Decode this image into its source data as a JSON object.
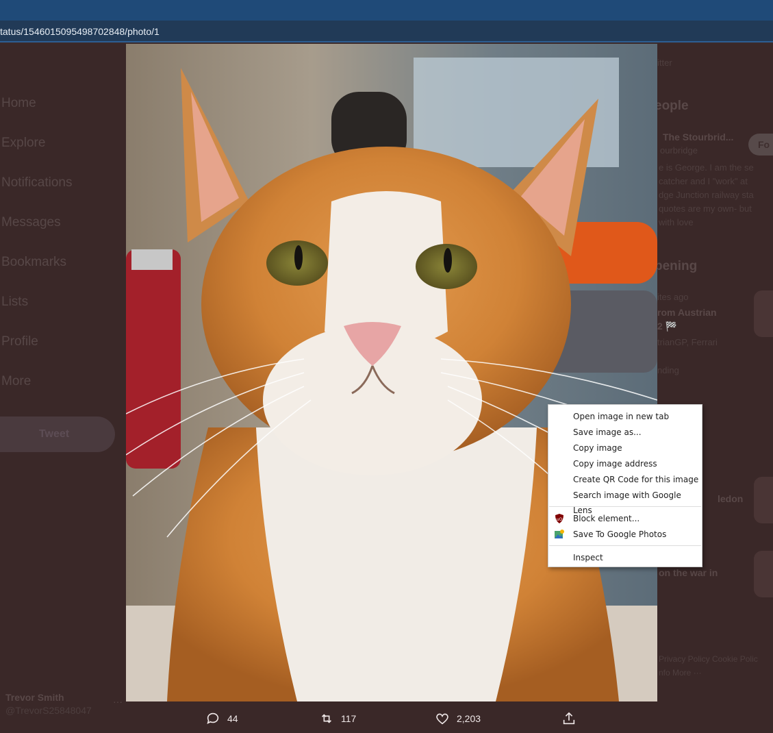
{
  "browser": {
    "url": "tatus/1546015095498702848/photo/1"
  },
  "sidebar": {
    "items": [
      {
        "label": "Home"
      },
      {
        "label": "Explore"
      },
      {
        "label": "Notifications"
      },
      {
        "label": "Messages"
      },
      {
        "label": "Bookmarks"
      },
      {
        "label": "Lists"
      },
      {
        "label": "Profile"
      },
      {
        "label": "More"
      }
    ],
    "tweet_button": "Tweet"
  },
  "account": {
    "name": "Trevor Smith",
    "handle": "@TrevorS25848047",
    "more": "···"
  },
  "right_column": {
    "search_hint": "itter",
    "people_heading": "eople",
    "person_name": "The Stourbrid...",
    "person_handle": "ourbridge",
    "follow_label": "Fo",
    "bio_lines": [
      "e is George. I am the se",
      "catcher and I \"work\" at",
      "dge Junction railway sta",
      "quotes are my own- but",
      "with love"
    ],
    "happening_heading": "pening",
    "trend_time": "ites ago",
    "trend_title_1": "rom Austrian",
    "trend_title_2": "2 🏁",
    "trend_sub": "trianGP, Ferrari",
    "trend_label": "nding",
    "trend_title_3": "ledon",
    "trend_title_4": "on the war in",
    "footer_1": "Privacy Policy   Cookie Polic",
    "footer_2": "nfo   More ···"
  },
  "tweet_actions": {
    "replies": "44",
    "retweets": "117",
    "likes": "2,203"
  },
  "context_menu": {
    "items": [
      {
        "label": "Open image in new tab"
      },
      {
        "label": "Save image as..."
      },
      {
        "label": "Copy image"
      },
      {
        "label": "Copy image address"
      },
      {
        "label": "Create QR Code for this image"
      },
      {
        "label": "Search image with Google Lens"
      },
      {
        "label": "Block element...",
        "icon": "ublock-shield-icon"
      },
      {
        "label": "Save To Google Photos",
        "icon": "google-photos-icon"
      },
      {
        "label": "Inspect"
      }
    ]
  },
  "colors": {
    "titlebar": "#1f4a78",
    "addressbar": "#213a57",
    "overlay": "#3a2828",
    "menu_bg": "#ffffff"
  }
}
